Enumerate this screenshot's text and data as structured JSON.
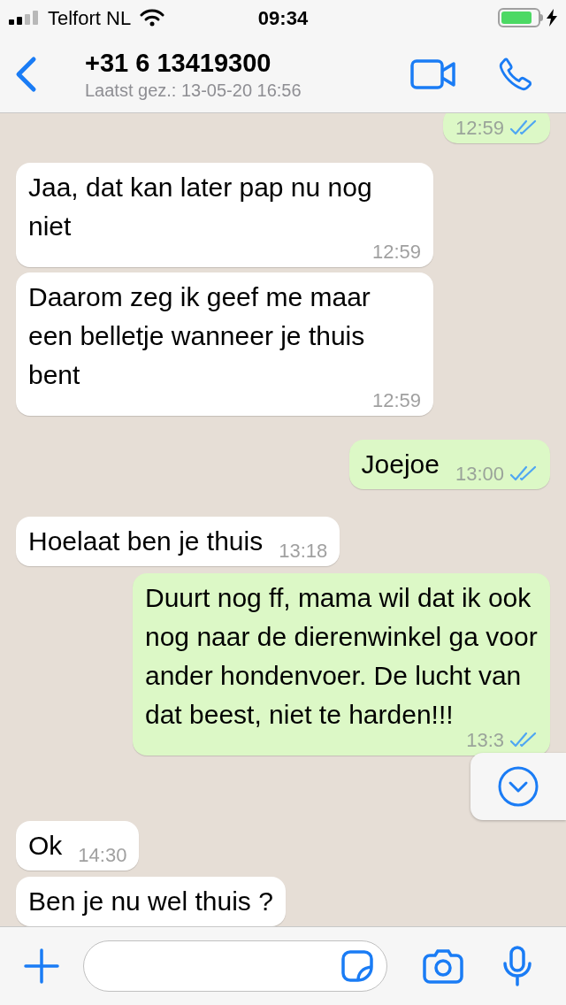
{
  "status_bar": {
    "carrier": "Telfort NL",
    "time": "09:34"
  },
  "header": {
    "title": "+31 6 13419300",
    "subtitle": "Laatst gez.: 13-05-20 16:56"
  },
  "messages": [
    {
      "kind": "sent",
      "time": "12:59",
      "ticks": true
    },
    {
      "kind": "received",
      "text": "Jaa, dat kan later pap nu nog niet",
      "time": "12:59",
      "ticks": false
    },
    {
      "kind": "received",
      "text": "Daarom zeg ik geef me maar een belletje wanneer je thuis bent",
      "time": "12:59",
      "ticks": false
    },
    {
      "kind": "sent",
      "text": "Joejoe",
      "time": "13:00",
      "ticks": true
    },
    {
      "kind": "received",
      "text": "Hoelaat ben je thuis",
      "time": "13:18",
      "ticks": false
    },
    {
      "kind": "sent",
      "text": "Duurt nog ff, mama wil dat ik ook nog naar de dierenwinkel ga voor ander hondenvoer. De lucht van dat beest, niet te harden!!!",
      "time": "13:3",
      "ticks": true
    },
    {
      "kind": "received",
      "text": "Ok",
      "time": "14:30",
      "ticks": false
    },
    {
      "kind": "received",
      "text": "Ben je nu wel thuis ?",
      "ticks": false
    }
  ]
}
